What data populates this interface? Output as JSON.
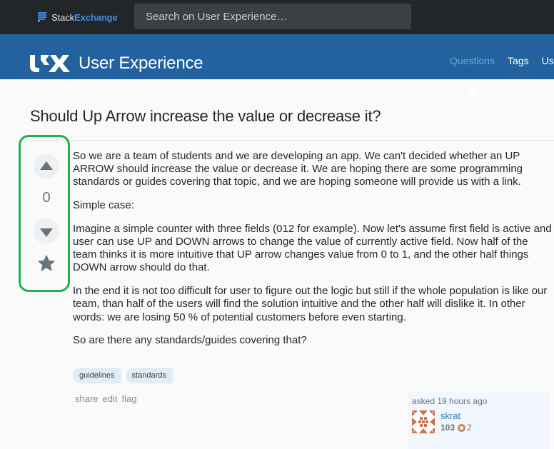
{
  "topbar": {
    "brand_part1": "Stack",
    "brand_part2": "Exchange",
    "search_placeholder": "Search on User Experience…"
  },
  "site": {
    "name": "User Experience",
    "logo_text": "UX",
    "nav": [
      {
        "label": "Questions",
        "active": true
      },
      {
        "label": "Tags",
        "active": false
      },
      {
        "label": "Us",
        "active": false
      }
    ]
  },
  "question": {
    "title": "Should Up Arrow increase the value or decrease it?",
    "score": "0",
    "body": [
      "So we are a team of students and we are developing an app. We can't decided whether an UP ARROW should increase the value or decrease it. We are hoping there are some programming standards or guides covering that topic, and we are hoping someone will provide us with a link.",
      "Simple case:",
      "Imagine a simple counter with three fields (012 for example). Now let's assume first field is active and user can use UP and DOWN arrows to change the value of currently active field. Now half of the team thinks it is more intuitive that UP arrow changes value from 0 to 1, and the other half things DOWN arrow should do that.",
      "In the end it is not too difficult for user to figure out the logic but still if the whole population is like our team, than half of the users will find the solution intuitive and the other half will dislike it. In other words: we are losing 50 % of potential customers before even starting.",
      "So are there any standards/guides covering that?"
    ],
    "tags": [
      "guidelines",
      "standards"
    ],
    "actions": [
      "share",
      "edit",
      "flag"
    ],
    "owner": {
      "asked": "asked 19 hours ago",
      "name": "skrat",
      "reputation": "103",
      "bronze_badges": "2"
    }
  },
  "colors": {
    "site_header": "#23629f",
    "topbar": "#232629",
    "highlight_border": "#22b14c",
    "tag_bg": "#e1ecf4",
    "link": "#3d7ab8"
  }
}
